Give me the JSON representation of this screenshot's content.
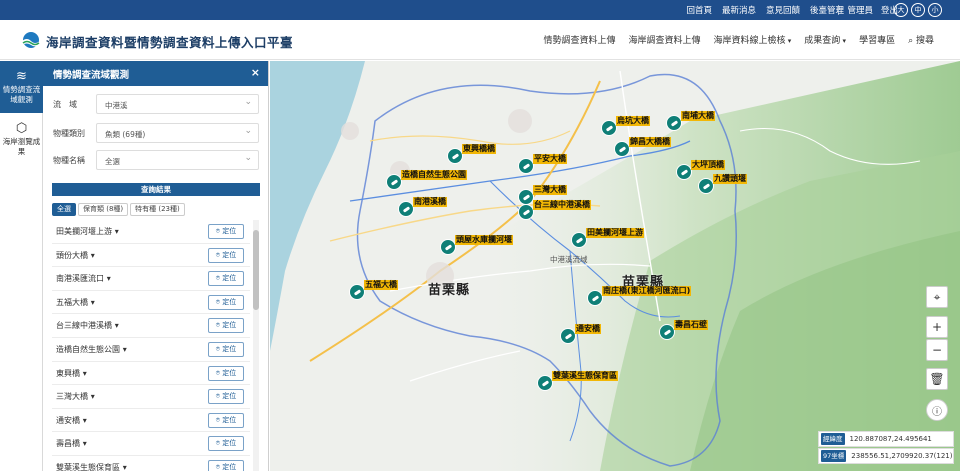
{
  "topbar": {
    "links": [
      "回首頁",
      "最新消息",
      "意見回饋",
      "後臺管理"
    ],
    "user": [
      "管理員",
      "登出"
    ],
    "font_sizes": [
      "大",
      "中",
      "小"
    ]
  },
  "header": {
    "title": "海岸調查資料暨情勢調查資料上傳入口平臺",
    "nav": [
      "情勢調查資料上傳",
      "海岸調查資料上傳",
      "海岸資料線上檢核",
      "成果查詢",
      "學習專區",
      "搜尋"
    ]
  },
  "rail": {
    "items": [
      {
        "label": "情勢調查流域觀測",
        "icon": "water-icon"
      },
      {
        "label": "海岸瀏覽成果",
        "icon": "cube-icon"
      }
    ]
  },
  "panel": {
    "title": "情勢調查流域觀測",
    "close": "×",
    "fields": [
      {
        "label": "流　域",
        "value": "中港溪"
      },
      {
        "label": "物種類別",
        "value": "魚類 (69種)"
      },
      {
        "label": "物種名稱",
        "value": "全選"
      }
    ],
    "results_title": "查詢結果",
    "tabs": [
      "全選",
      "保育類 (8種)",
      "特有種 (23種)"
    ],
    "locate_label": "定位",
    "results": [
      "田美攔河堰上游",
      "頭份大橋",
      "南港溪匯流口",
      "五福大橋",
      "台三線中港溪橋",
      "造橋自然生態公園",
      "東興橋",
      "三灣大橋",
      "通安橋",
      "壽昌橋",
      "雙葉溪生態保育區"
    ]
  },
  "map": {
    "county_labels": [
      "苗栗縣",
      "苗栗縣"
    ],
    "place_labels": [
      "中港溪流域"
    ],
    "markers": [
      {
        "label": "烏坑大橋"
      },
      {
        "label": "南埔大橋"
      },
      {
        "label": "錦昌大橋橋"
      },
      {
        "label": "東興橋橋"
      },
      {
        "label": "平安大橋"
      },
      {
        "label": "大坪頂橋"
      },
      {
        "label": "造橋自然生態公園"
      },
      {
        "label": "九讚頭堰"
      },
      {
        "label": "三灣大橋"
      },
      {
        "label": "台三線中港溪橋"
      },
      {
        "label": "南港溪橋"
      },
      {
        "label": "田美攔河堰上游"
      },
      {
        "label": "頭屋水庫攔河堰"
      },
      {
        "label": "五福大橋"
      },
      {
        "label": "南庄橋(東江橋河匯流口)"
      },
      {
        "label": "通安橋"
      },
      {
        "label": "壽昌石壁"
      },
      {
        "label": "雙葉溪生態保育區"
      }
    ],
    "coords": [
      {
        "tag": "經緯度",
        "value": "120.887087,24.495641"
      },
      {
        "tag": "97坐標",
        "value": "238556.51,2709920.37(121)"
      }
    ]
  },
  "colors": {
    "primary": "#1f5d95",
    "marker": "#0f7f77",
    "label_bg": "#f2b705"
  }
}
